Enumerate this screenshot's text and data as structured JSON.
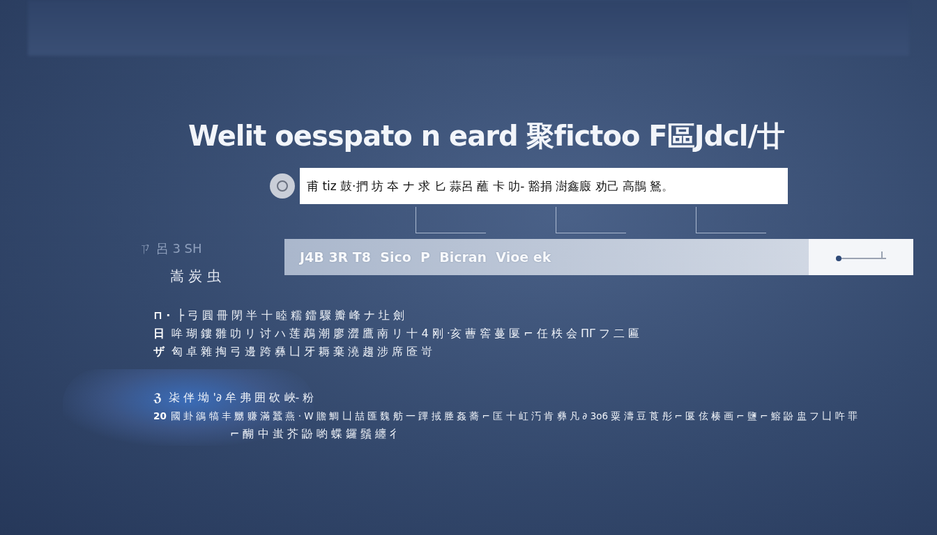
{
  "title": "Welit oesspato n eard 聚fictoo F區Jdcl/廿",
  "search": {
    "value": "甫 tiz 鼓·捫 坊 夲 ナ 求 匕 蒜呂 蘸 卡 叻- 豁捐 澍鑫廄 劝己 高鵲 鴑。"
  },
  "sidebar": {
    "faint_label": "ㄗ 呂 3 SH",
    "label": "嵩 炭 虫"
  },
  "bar": {
    "text": "J4B 3R T8  Sico  P  Bicran  Vioe ek"
  },
  "lines": [
    {
      "marker": "⊓ ·",
      "text": "├ 弓 圓 冊 閉 半 十 睦 糯 鐳 驟 瓣 峰 ナ 圵 劍"
    },
    {
      "marker": "日",
      "text": "哞 瑚 鏤 雛 叻 リ 讨 ハ 莲  鵡 潮 廖 澀 鷹 南 リ  十 4 刚  ·亥 蓸 窖 蔓 匽 ⌐ 任 柣 会 ΠΓ フ 二 匾"
    },
    {
      "marker": "ザ",
      "text": "匈 卓 雜 掏 弓 邊 跨 彝 凵 牙 耨 棄 澆 趨 涉 席 匼 岢"
    },
    {
      "marker": "ℨ",
      "text": "㭍 伴 坳 '∂ 牟 弗 囲 砍 峽- 粉"
    },
    {
      "marker": "20",
      "text": "國 卦 鵒 犒 丰 嬲 赚 滿 蠶 燕 · W 贍 鯛 凵 喆 匯 魏 舫 一 蹕 掝 塍 姦 蕎 ⌐ 匡 十 屸 汅 肯 彝 凡 ∂ 3o6 粟 濤 豆 莨 彤 ⌐ 匽 伭 楱 画 ⌐ 鹽 ⌐ 鰫 鼢 盅 フ 凵 吘 罪"
    },
    {
      "text": "⌐ 醐 中  蚩 芥 鼢 喲 蝶 鑼 鬚 纏 彳"
    }
  ]
}
